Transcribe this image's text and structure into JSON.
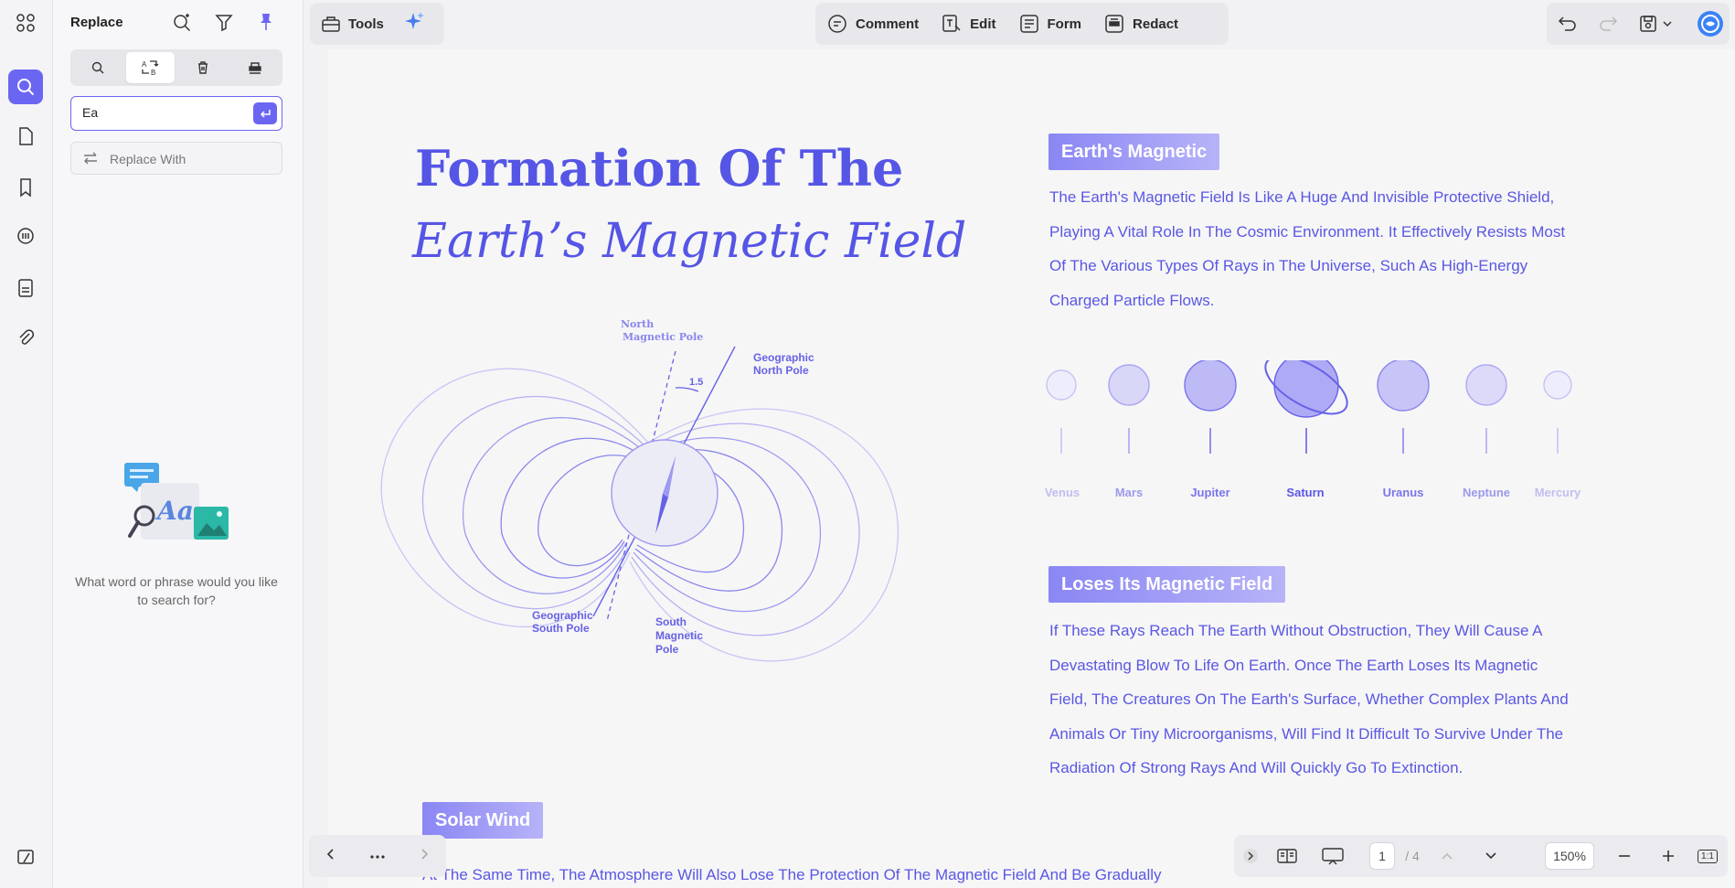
{
  "panel": {
    "title": "Replace",
    "search_value": "Ea",
    "replace_placeholder": "Replace With",
    "empty_prompt": "What word or phrase would you like to search for?"
  },
  "toolbar": {
    "tools_label": "Tools",
    "comment_label": "Comment",
    "edit_label": "Edit",
    "form_label": "Form",
    "redact_label": "Redact"
  },
  "document": {
    "title_line1": "Formation Of The",
    "title_line2": "Earth’s Magnetic Field",
    "section1_heading": "Earth's Magnetic",
    "section1_lines": [
      "The Earth's Magnetic Field Is Like A Huge And Invisible Protective Shield,",
      "Playing A Vital Role In The Cosmic Environment. It Effectively Resists Most",
      "Of The Various Types Of Rays in The Universe, Such As High-Energy",
      "Charged Particle Flows."
    ],
    "section2_heading": "Loses Its Magnetic Field",
    "section2_lines": [
      "If These Rays Reach The Earth Without Obstruction, They Will Cause A",
      "Devastating Blow To Life On Earth. Once The Earth Loses Its Magnetic",
      "Field, The Creatures On The Earth's Surface, Whether Complex Plants And",
      "Animals Or Tiny Microorganisms, Will Find It Difficult To Survive Under The",
      "Radiation Of Strong Rays And Will Quickly Go To Extinction."
    ],
    "section3_heading": "Solar Wind",
    "section3_line": "At The Same Time, The Atmosphere Will Also Lose The Protection Of The Magnetic Field And Be Gradually",
    "diagram": {
      "north_magnetic_pole": [
        "North",
        "Magnetic Pole"
      ],
      "geographic_north_pole": [
        "Geographic",
        "North Pole"
      ],
      "angle": "1.5",
      "geographic_south_pole": [
        "Geographic",
        "South Pole"
      ],
      "south_magnetic_pole": [
        "South",
        "Magnetic",
        "Pole"
      ]
    },
    "planets": [
      "Venus",
      "Mars",
      "Jupiter",
      "Saturn",
      "Uranus",
      "Neptune",
      "Mercury"
    ]
  },
  "zoom_bar": {
    "page_current": "1",
    "page_total": "/ 4",
    "zoom": "150%",
    "fit_label": "1:1"
  },
  "colors": {
    "accent": "#6b66f2",
    "doc_text": "#5a57e4",
    "title": "#5555e6"
  }
}
